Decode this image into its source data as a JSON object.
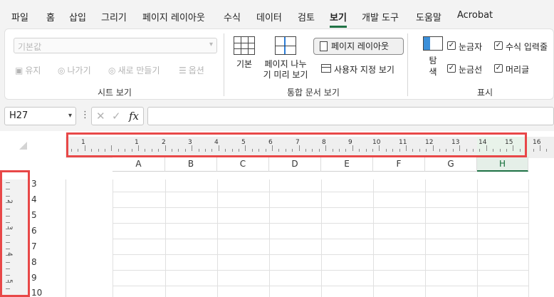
{
  "menu": {
    "tabs": [
      "파일",
      "홈",
      "삽입",
      "그리기",
      "페이지 레이아웃",
      "수식",
      "데이터",
      "검토",
      "보기",
      "개발 도구",
      "도움말",
      "Acrobat"
    ],
    "active": "보기"
  },
  "ribbon": {
    "sheet_view": {
      "select_value": "기본값",
      "keep": "유지",
      "exit": "나가기",
      "new": "새로 만들기",
      "options": "옵션",
      "group_label": "시트 보기"
    },
    "workbook_views": {
      "normal": "기본",
      "page_break_line1": "페이지 나누",
      "page_break_line2": "기 미리 보기",
      "page_layout": "페이지 레이아웃",
      "custom_views": "사용자 지정 보기",
      "group_label": "통합 문서 보기"
    },
    "show": {
      "navigation_line1": "탐",
      "navigation_line2": "색",
      "ruler": "눈금자",
      "formula_bar": "수식 입력줄",
      "gridlines": "눈금선",
      "headings": "머리글",
      "group_label": "표시",
      "ruler_checked": true,
      "formula_bar_checked": true,
      "gridlines_checked": true,
      "headings_checked": true
    }
  },
  "formula_bar": {
    "name_box": "H27",
    "formula_value": ""
  },
  "sheet": {
    "columns": [
      "A",
      "B",
      "C",
      "D",
      "E",
      "F",
      "G",
      "H"
    ],
    "active_column": "H",
    "rows": [
      "3",
      "4",
      "5",
      "6",
      "7",
      "8",
      "9",
      "10"
    ],
    "h_ruler_numbers": [
      "1",
      "1",
      "2",
      "3",
      "4",
      "5",
      "6",
      "7",
      "8",
      "9",
      "10",
      "11",
      "12",
      "13",
      "14",
      "15",
      "16"
    ],
    "v_ruler_numbers": [
      "2",
      "3",
      "4",
      "5"
    ]
  },
  "colors": {
    "accent": "#217346",
    "highlight": "#e84848"
  }
}
